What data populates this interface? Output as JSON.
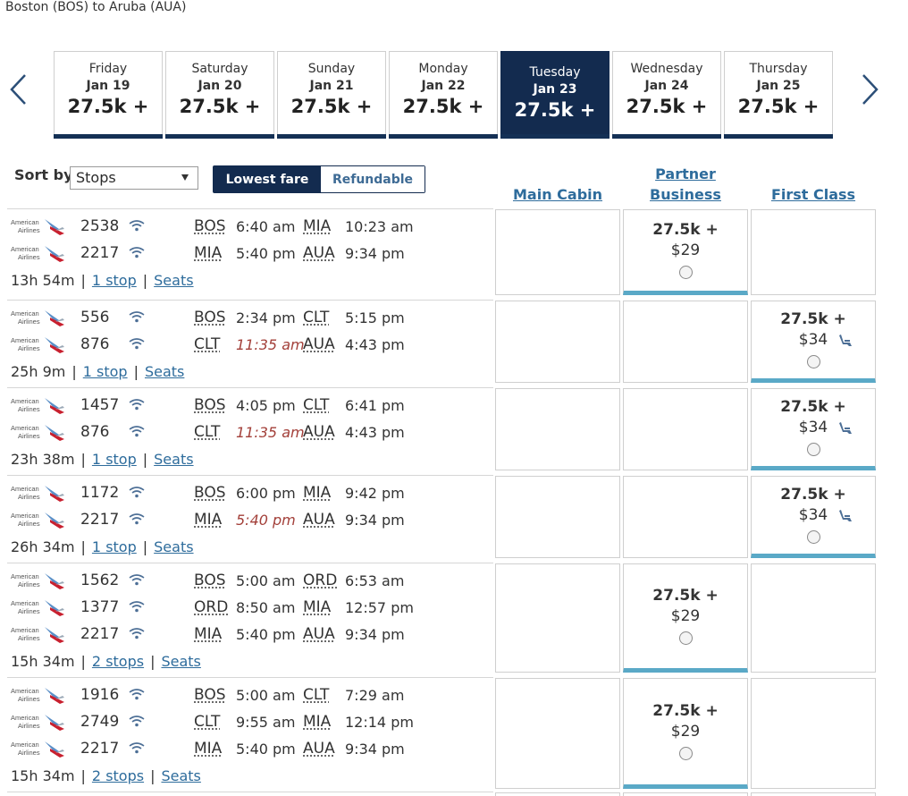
{
  "route_title": "Boston (BOS) to Aruba (AUA)",
  "date_tabs": [
    {
      "dow": "Friday",
      "dm": "Jan 19",
      "price": "27.5k +"
    },
    {
      "dow": "Saturday",
      "dm": "Jan 20",
      "price": "27.5k +"
    },
    {
      "dow": "Sunday",
      "dm": "Jan 21",
      "price": "27.5k +"
    },
    {
      "dow": "Monday",
      "dm": "Jan 22",
      "price": "27.5k +"
    },
    {
      "dow": "Tuesday",
      "dm": "Jan 23",
      "price": "27.5k +",
      "active": true
    },
    {
      "dow": "Wednesday",
      "dm": "Jan 24",
      "price": "27.5k +"
    },
    {
      "dow": "Thursday",
      "dm": "Jan 25",
      "price": "27.5k +"
    }
  ],
  "sort": {
    "label": "Sort by",
    "value": "Stops"
  },
  "fare_toggle": {
    "lowest": "Lowest fare",
    "refundable": "Refundable"
  },
  "columns": {
    "main_cabin": "Main Cabin",
    "partner_business": "Partner Business",
    "first_class": "First Class"
  },
  "colors": {
    "navy": "#132b4f",
    "link": "#2e6c9c",
    "late": "#a3403a",
    "fare_bar": "#5aa9c7"
  },
  "flights": [
    {
      "legs": [
        {
          "fno": "2538",
          "from": "BOS",
          "dep": "6:40 am",
          "to": "MIA",
          "arr": "10:23 am",
          "dep_late": false
        },
        {
          "fno": "2217",
          "from": "MIA",
          "dep": "5:40 pm",
          "to": "AUA",
          "arr": "9:34 pm",
          "dep_late": false
        }
      ],
      "duration": "13h 54m",
      "stops": "1 stop",
      "seats": "Seats",
      "fares": {
        "main": null,
        "partner": {
          "miles": "27.5k +",
          "cash": "$29",
          "seat_icon": false
        },
        "first": null
      }
    },
    {
      "legs": [
        {
          "fno": "556",
          "from": "BOS",
          "dep": "2:34 pm",
          "to": "CLT",
          "arr": "5:15 pm",
          "dep_late": false
        },
        {
          "fno": "876",
          "from": "CLT",
          "dep": "11:35 am",
          "to": "AUA",
          "arr": "4:43 pm",
          "dep_late": true
        }
      ],
      "duration": "25h 9m",
      "stops": "1 stop",
      "seats": "Seats",
      "fares": {
        "main": null,
        "partner": null,
        "first": {
          "miles": "27.5k +",
          "cash": "$34",
          "seat_icon": true
        }
      }
    },
    {
      "legs": [
        {
          "fno": "1457",
          "from": "BOS",
          "dep": "4:05 pm",
          "to": "CLT",
          "arr": "6:41 pm",
          "dep_late": false
        },
        {
          "fno": "876",
          "from": "CLT",
          "dep": "11:35 am",
          "to": "AUA",
          "arr": "4:43 pm",
          "dep_late": true
        }
      ],
      "duration": "23h 38m",
      "stops": "1 stop",
      "seats": "Seats",
      "fares": {
        "main": null,
        "partner": null,
        "first": {
          "miles": "27.5k +",
          "cash": "$34",
          "seat_icon": true
        }
      }
    },
    {
      "legs": [
        {
          "fno": "1172",
          "from": "BOS",
          "dep": "6:00 pm",
          "to": "MIA",
          "arr": "9:42 pm",
          "dep_late": false
        },
        {
          "fno": "2217",
          "from": "MIA",
          "dep": "5:40 pm",
          "to": "AUA",
          "arr": "9:34 pm",
          "dep_late": true
        }
      ],
      "duration": "26h 34m",
      "stops": "1 stop",
      "seats": "Seats",
      "fares": {
        "main": null,
        "partner": null,
        "first": {
          "miles": "27.5k +",
          "cash": "$34",
          "seat_icon": true
        }
      }
    },
    {
      "legs": [
        {
          "fno": "1562",
          "from": "BOS",
          "dep": "5:00 am",
          "to": "ORD",
          "arr": "6:53 am",
          "dep_late": false
        },
        {
          "fno": "1377",
          "from": "ORD",
          "dep": "8:50 am",
          "to": "MIA",
          "arr": "12:57 pm",
          "dep_late": false
        },
        {
          "fno": "2217",
          "from": "MIA",
          "dep": "5:40 pm",
          "to": "AUA",
          "arr": "9:34 pm",
          "dep_late": false
        }
      ],
      "duration": "15h 34m",
      "stops": "2 stops",
      "seats": "Seats",
      "fares": {
        "main": null,
        "partner": {
          "miles": "27.5k +",
          "cash": "$29",
          "seat_icon": false
        },
        "first": null
      }
    },
    {
      "legs": [
        {
          "fno": "1916",
          "from": "BOS",
          "dep": "5:00 am",
          "to": "CLT",
          "arr": "7:29 am",
          "dep_late": false
        },
        {
          "fno": "2749",
          "from": "CLT",
          "dep": "9:55 am",
          "to": "MIA",
          "arr": "12:14 pm",
          "dep_late": false
        },
        {
          "fno": "2217",
          "from": "MIA",
          "dep": "5:40 pm",
          "to": "AUA",
          "arr": "9:34 pm",
          "dep_late": false
        }
      ],
      "duration": "15h 34m",
      "stops": "2 stops",
      "seats": "Seats",
      "fares": {
        "main": null,
        "partner": {
          "miles": "27.5k +",
          "cash": "$29",
          "seat_icon": false
        },
        "first": null
      }
    }
  ]
}
